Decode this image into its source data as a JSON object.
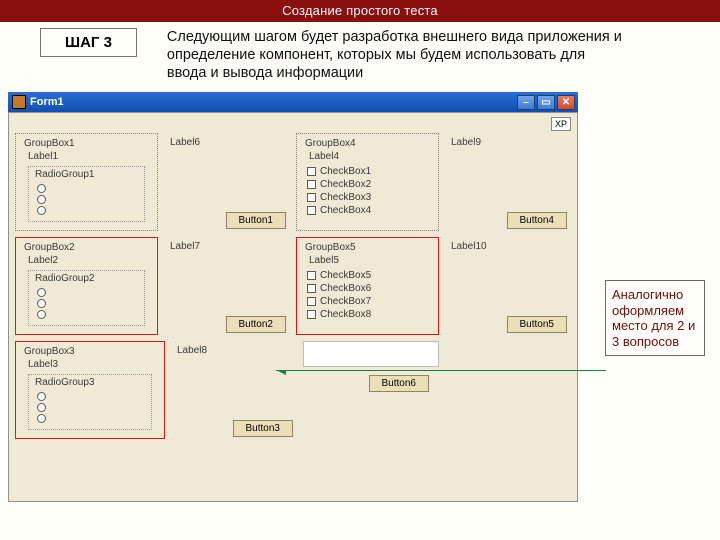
{
  "banner": "Создание простого теста",
  "step": {
    "label": "ШАГ 3"
  },
  "description": "Следующим шагом будет разработка внешнего вида приложения и определение компонент, которых мы будем использовать для ввода и вывода информации",
  "window": {
    "title": "Form1",
    "xp_badge": "XP"
  },
  "groups": [
    {
      "caption": "GroupBox1",
      "label": "Label1",
      "radio": {
        "caption": "RadioGroup1",
        "items": [
          "",
          "",
          ""
        ]
      },
      "sideLabel": "Label6",
      "button": "Button1"
    },
    {
      "caption": "GroupBox4",
      "label": "Label4",
      "checks": [
        "CheckBox1",
        "CheckBox2",
        "CheckBox3",
        "CheckBox4"
      ],
      "sideLabel": "Label9",
      "button": "Button4"
    },
    {
      "caption": "GroupBox2",
      "label": "Label2",
      "radio": {
        "caption": "RadioGroup2",
        "items": [
          "",
          "",
          ""
        ]
      },
      "sideLabel": "Label7",
      "button": "Button2"
    },
    {
      "caption": "GroupBox5",
      "label": "Label5",
      "checks": [
        "CheckBox5",
        "CheckBox6",
        "CheckBox7",
        "CheckBox8"
      ],
      "sideLabel": "Label10",
      "button": "Button5"
    },
    {
      "caption": "GroupBox3",
      "label": "Label3",
      "radio": {
        "caption": "RadioGroup3",
        "items": [
          "",
          "",
          ""
        ]
      },
      "sideLabel": "Label8",
      "button": "Button3"
    }
  ],
  "footerButton": "Button6",
  "annotation": "Аналогично оформляем место для 2 и 3 вопросов"
}
